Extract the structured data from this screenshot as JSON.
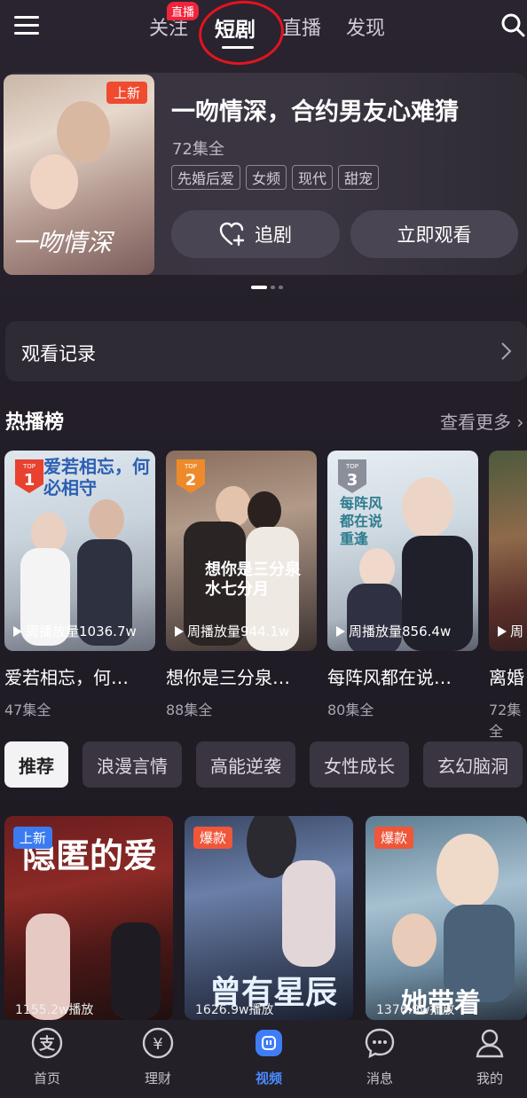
{
  "topnav": {
    "tabs": [
      "关注",
      "短剧",
      "直播",
      "发现"
    ],
    "live_badge": "直播",
    "active_tab": "短剧"
  },
  "hero": {
    "badge": "上新",
    "poster_art_text": "一吻情深",
    "title": "一吻情深，合约男友心难猜",
    "episodes": "72集全",
    "tags": [
      "先婚后爱",
      "女频",
      "现代",
      "甜宠"
    ],
    "follow_label": "追剧",
    "watch_label": "立即观看",
    "carousel_pages": 3,
    "carousel_active": 1
  },
  "history": {
    "label": "观看记录"
  },
  "hot": {
    "title": "热播榜",
    "more": "查看更多",
    "items": [
      {
        "rank": "1",
        "rank_label": "TOP",
        "art": "爱若相忘，何必相守",
        "plays": "周播放量1036.7w",
        "name": "爱若相忘，何…",
        "eps": "47集全",
        "rank_color": "#e8412f"
      },
      {
        "rank": "2",
        "rank_label": "TOP",
        "art": "想你是三分泉水七分月",
        "plays": "周播放量944.1w",
        "name": "想你是三分泉…",
        "eps": "88集全",
        "rank_color": "#ef8a2a"
      },
      {
        "rank": "3",
        "rank_label": "TOP",
        "art": "每阵风都在说重逢",
        "plays": "周播放量856.4w",
        "name": "每阵风都在说…",
        "eps": "80集全",
        "rank_color": "#8b8f9a"
      },
      {
        "rank": "",
        "rank_label": "",
        "art": "",
        "plays": "周",
        "name": "离婚",
        "eps": "72集全",
        "rank_color": ""
      }
    ]
  },
  "chips": [
    "推荐",
    "浪漫言情",
    "高能逆袭",
    "女性成长",
    "玄幻脑洞"
  ],
  "recommend": [
    {
      "badge": "上新",
      "badge_color": "#3b7bf0",
      "art": "隐匿的爱",
      "plays": "1155.2w播放"
    },
    {
      "badge": "爆款",
      "badge_color": "#f0563a",
      "art": "曾有星辰",
      "plays": "1626.9w播放"
    },
    {
      "badge": "爆款",
      "badge_color": "#f0563a",
      "art": "她带着",
      "plays": "1376.9w播放"
    }
  ],
  "bottom": {
    "items": [
      "首页",
      "理财",
      "视频",
      "消息",
      "我的"
    ],
    "active": "视频",
    "active_color": "#4b8bff"
  }
}
